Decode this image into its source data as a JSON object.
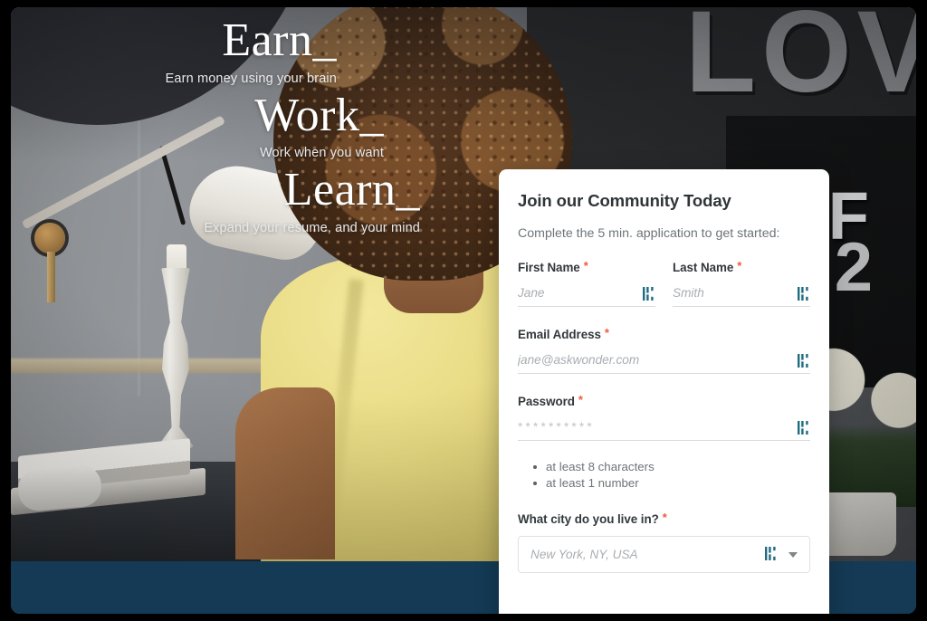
{
  "hero": {
    "lines": [
      {
        "title": "Earn_",
        "subtitle": "Earn money using your brain"
      },
      {
        "title": "Work_",
        "subtitle": "Work when you want"
      },
      {
        "title": "Learn_",
        "subtitle": "Expand your resume, and your mind"
      }
    ]
  },
  "background": {
    "sign_text": "LOV",
    "board_letter_1": "F",
    "board_letter_2": "F",
    "board_letter_3": "2",
    "navy_band_color": "#143a55"
  },
  "signup": {
    "title": "Join our Community Today",
    "subtitle": "Complete the 5 min. application to get started:",
    "required_marker": "*",
    "required_color": "#f05a3c",
    "fields": {
      "first_name": {
        "label": "First Name",
        "placeholder": "Jane",
        "value": "",
        "icon": "password-manager-icon"
      },
      "last_name": {
        "label": "Last Name",
        "placeholder": "Smith",
        "value": "",
        "icon": "password-manager-icon"
      },
      "email": {
        "label": "Email Address",
        "placeholder": "jane@askwonder.com",
        "value": "",
        "icon": "password-manager-icon"
      },
      "password": {
        "label": "Password",
        "placeholder": "",
        "value": "**********",
        "icon": "password-manager-icon"
      },
      "city": {
        "label": "What city do you live in?",
        "placeholder": "New York, NY, USA",
        "value": "",
        "icon": "password-manager-icon"
      }
    },
    "password_rules": [
      "at least 8 characters",
      "at least 1 number"
    ]
  }
}
